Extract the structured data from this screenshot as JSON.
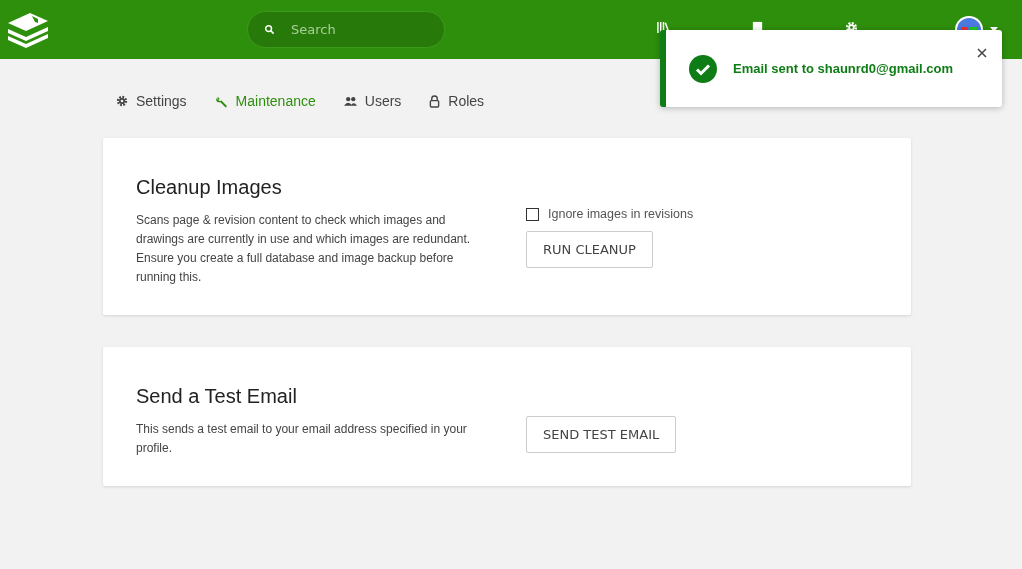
{
  "header": {
    "search": {
      "placeholder": "Search"
    }
  },
  "tabs": [
    {
      "label": "Settings",
      "selected": false
    },
    {
      "label": "Maintenance",
      "selected": true
    },
    {
      "label": "Users",
      "selected": false
    },
    {
      "label": "Roles",
      "selected": false
    }
  ],
  "cards": [
    {
      "title": "Cleanup Images",
      "description": "Scans page & revision content to check which images and drawings are currently in use and which images are redundant. Ensure you create a full database and image backup before running this.",
      "checkbox": {
        "label": "Ignore images in revisions",
        "checked": false
      },
      "button": "RUN CLEANUP"
    },
    {
      "title": "Send a Test Email",
      "description": "This sends a test email to your email address specified in your profile.",
      "button": "SEND TEST EMAIL"
    }
  ],
  "toast": {
    "message": "Email sent to shaunrd0@gmail.com"
  }
}
